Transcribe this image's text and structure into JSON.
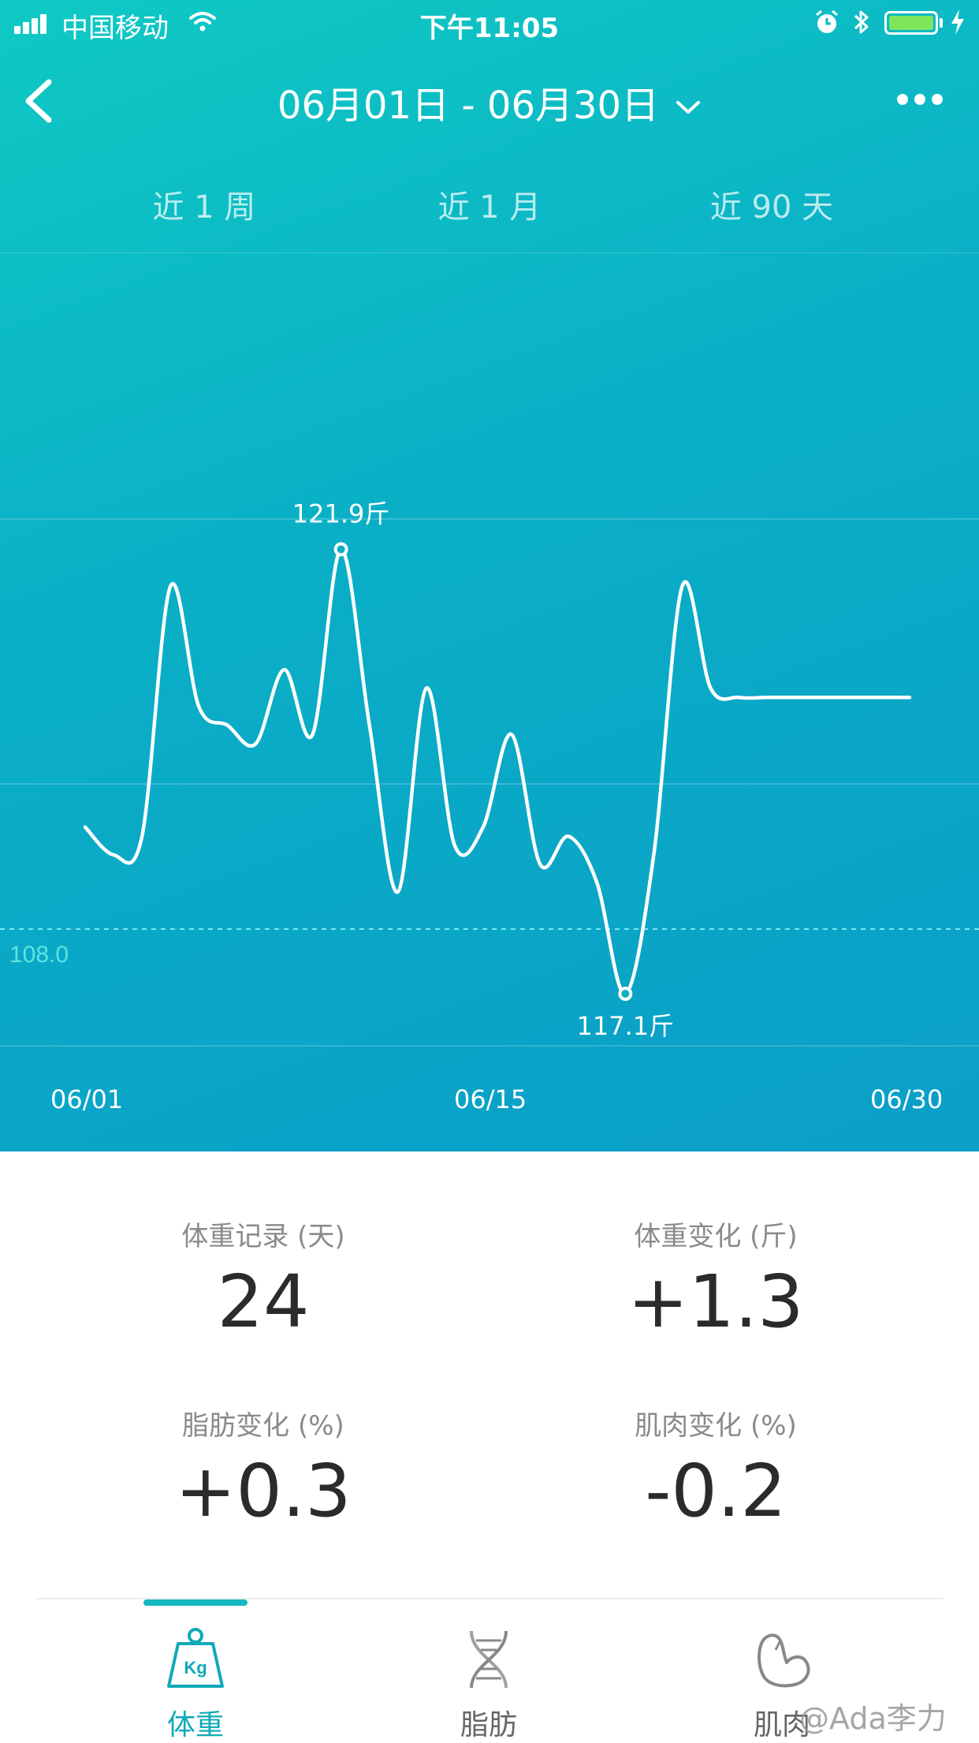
{
  "status_bar": {
    "carrier": "中国移动",
    "time": "下午11:05"
  },
  "header": {
    "date_range": "06月01日 - 06月30日"
  },
  "periods": [
    "近 1 周",
    "近 1 月",
    "近 90 天"
  ],
  "colors": {
    "accent": "#10aab8",
    "hero_start": "#0fc9c4",
    "hero_end": "#0a9ec8",
    "battery": "#7ee55d"
  },
  "chart_data": {
    "type": "line",
    "series": [
      {
        "x": [
          "06/01",
          "06/02",
          "06/03",
          "06/04",
          "06/05",
          "06/06",
          "06/07",
          "06/08",
          "06/09",
          "06/10",
          "06/11",
          "06/12",
          "06/13",
          "06/14",
          "06/15",
          "06/16",
          "06/17",
          "06/18",
          "06/19",
          "06/20",
          "06/21",
          "06/22",
          "06/23",
          "06/24",
          "06/25",
          "06/26",
          "06/27",
          "06/28",
          "06/29",
          "06/30"
        ],
        "values": [
          118.9,
          118.6,
          118.8,
          121.5,
          120.2,
          120.0,
          119.8,
          120.6,
          119.9,
          121.9,
          120.0,
          118.2,
          120.4,
          118.7,
          118.9,
          119.9,
          118.5,
          118.8,
          118.3,
          117.1,
          118.6,
          121.5,
          120.4,
          120.3,
          120.3,
          120.3,
          120.3,
          120.3,
          120.3,
          120.3
        ]
      }
    ],
    "annotations": [
      {
        "label": "121.9斤",
        "x": "06/10",
        "value": 121.9,
        "kind": "max"
      },
      {
        "label": "117.1斤",
        "x": "06/20",
        "value": 117.1,
        "kind": "min"
      }
    ],
    "reference_line": {
      "value": 108.0,
      "label": "108.0",
      "style": "dashed"
    },
    "x_ticks": [
      "06/01",
      "06/15",
      "06/30"
    ],
    "grid": true
  },
  "stats": [
    {
      "label": "体重记录 (天)",
      "value": "24"
    },
    {
      "label": "体重变化 (斤)",
      "value": "+1.3"
    },
    {
      "label": "脂肪变化 (%)",
      "value": "+0.3"
    },
    {
      "label": "肌肉变化 (%)",
      "value": "-0.2"
    }
  ],
  "tabs": [
    {
      "label": "体重",
      "icon": "kg-weight-icon",
      "icon_text": "Kg",
      "active": true
    },
    {
      "label": "脂肪",
      "icon": "dna-icon",
      "active": false
    },
    {
      "label": "肌肉",
      "icon": "muscle-arm-icon",
      "active": false
    }
  ],
  "watermark": "@Ada李力"
}
